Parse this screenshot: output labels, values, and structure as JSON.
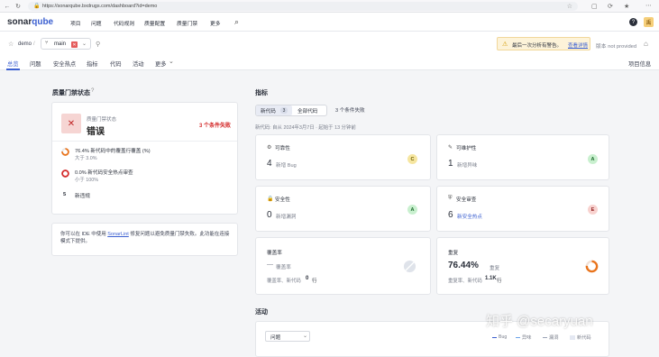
{
  "browser": {
    "url": "https://sonarqube.bxdrugs.com/dashboard?id=demo"
  },
  "nav": {
    "logo_prefix": "sonar",
    "logo_suffix": "qube",
    "items": [
      "项目",
      "问题",
      "代码规则",
      "质量配置",
      "质量门禁",
      "更多"
    ],
    "help_label": "?",
    "avatar_letter": "禹"
  },
  "project": {
    "name": "demo",
    "branch": "main",
    "branch_badge": "✕",
    "warning_text": "最后一次分析有警告。",
    "warning_link": "查看详情",
    "not_provided": "版本 not provided",
    "tabs": [
      "总览",
      "问题",
      "安全热点",
      "指标",
      "代码",
      "活动",
      "更多"
    ],
    "project_info": "项目信息"
  },
  "gate": {
    "title": "质量门禁状态",
    "status_label": "质量门禁状态",
    "status": "错误",
    "failed_count": "3 个条件失败",
    "conditions": [
      {
        "line1": "76.4% 新代码中的覆盖行覆盖 (%)",
        "line2": "大于 3.0%"
      },
      {
        "line1": "0.0% 新代码安全热点审查",
        "line2": "小于 100%"
      },
      {
        "line1": "新违规",
        "line2": ""
      }
    ],
    "condition3_value": "5",
    "tip_part1": "你可以在 IDE 中使用 ",
    "tip_link": "SonarLint",
    "tip_part2": " 修复问题以避免质量门禁失败。此功能在连接模式下提供。"
  },
  "measures": {
    "title": "指标",
    "tab_new": "新代码",
    "tab_new_count": "3",
    "tab_all": "全部代码",
    "conditions_failed": "3 个条件失败",
    "since_line": "新代码: 自从 2024年3月7日 · 起始于 13 分钟前",
    "tiles": [
      {
        "title": "可靠性",
        "value": "4",
        "label": "新增 Bug",
        "grade": "C"
      },
      {
        "title": "可维护性",
        "value": "1",
        "label": "新增异味",
        "grade": "A"
      },
      {
        "title": "安全性",
        "value": "0",
        "label": "新增漏洞",
        "grade": "A"
      },
      {
        "title": "安全审查",
        "value": "6",
        "label": "新安全热点",
        "grade": "E"
      },
      {
        "title": "覆盖率",
        "value": "—",
        "label": "覆盖率",
        "extra_label": "覆盖率、新代码",
        "extra_value": "0",
        "extra_unit": "行"
      },
      {
        "title": "重复",
        "value": "76.44%",
        "label": "重复",
        "extra_label": "重复率、新代码",
        "extra_value": "1.1K",
        "extra_unit": "行"
      }
    ]
  },
  "activity": {
    "title": "活动",
    "select_value": "问题",
    "legend": [
      "Bug",
      "异味",
      "漏洞",
      "新代码"
    ]
  },
  "watermark": "知乎 @secaryuan",
  "colors": {
    "grade_C": "#f6e6a0",
    "grade_A": "#c9f0cf",
    "grade_E": "#f8d2cf",
    "error_red": "#d42c2c",
    "link_blue": "#3b5fd0"
  }
}
